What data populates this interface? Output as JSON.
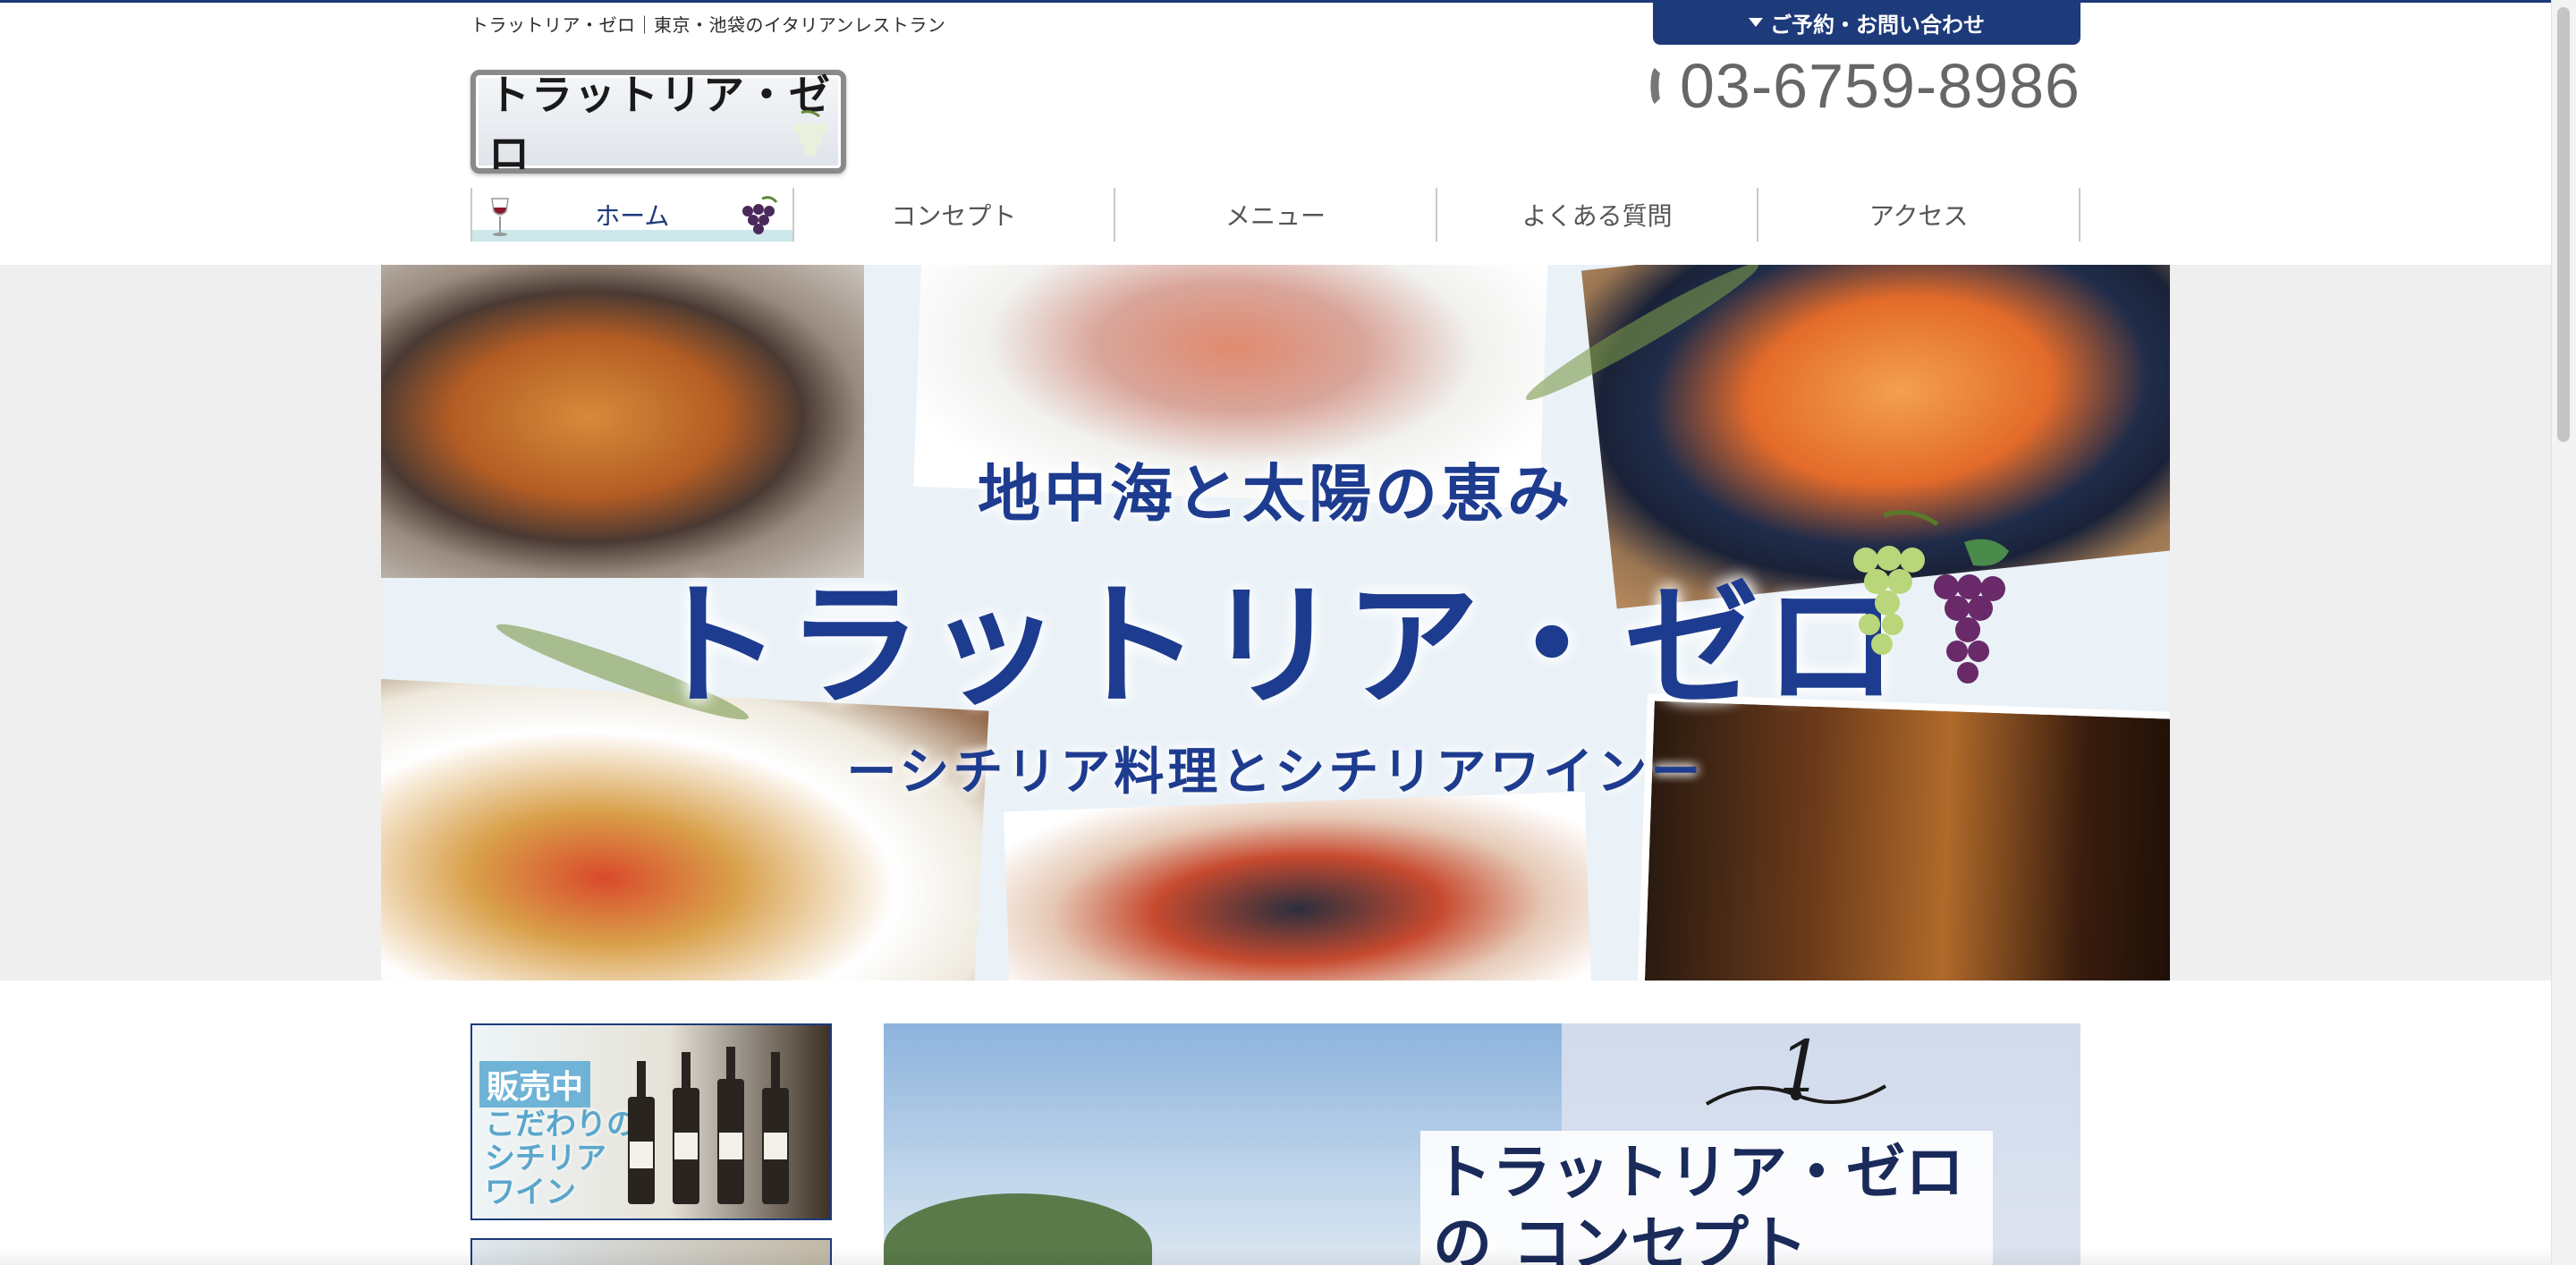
{
  "header": {
    "tagline": "トラットリア・ゼロ｜東京・池袋のイタリアンレストラン",
    "reserve_label": "ご予約・お問い合わせ",
    "phone": "03-6759-8986",
    "logo_text": "トラットリア・ゼロ"
  },
  "nav": {
    "items": [
      {
        "label": "ホーム"
      },
      {
        "label": "コンセプト"
      },
      {
        "label": "メニュー"
      },
      {
        "label": "よくある質問"
      },
      {
        "label": "アクセス"
      }
    ]
  },
  "hero": {
    "subtitle": "地中海と太陽の恵み",
    "title": "トラットリア・ゼロ",
    "tagline": "ーシチリア料理とシチリアワインー"
  },
  "sidebar": {
    "banner_tag": "販売中",
    "banner_text": "こだわりの シチリア ワイン"
  },
  "concept": {
    "number": "1",
    "title": "トラットリア・ゼロの コンセプト"
  },
  "colors": {
    "brand": "#1d3a7a",
    "hero_text": "#1e3c8f",
    "active_nav_underline": "#cde7ea"
  }
}
